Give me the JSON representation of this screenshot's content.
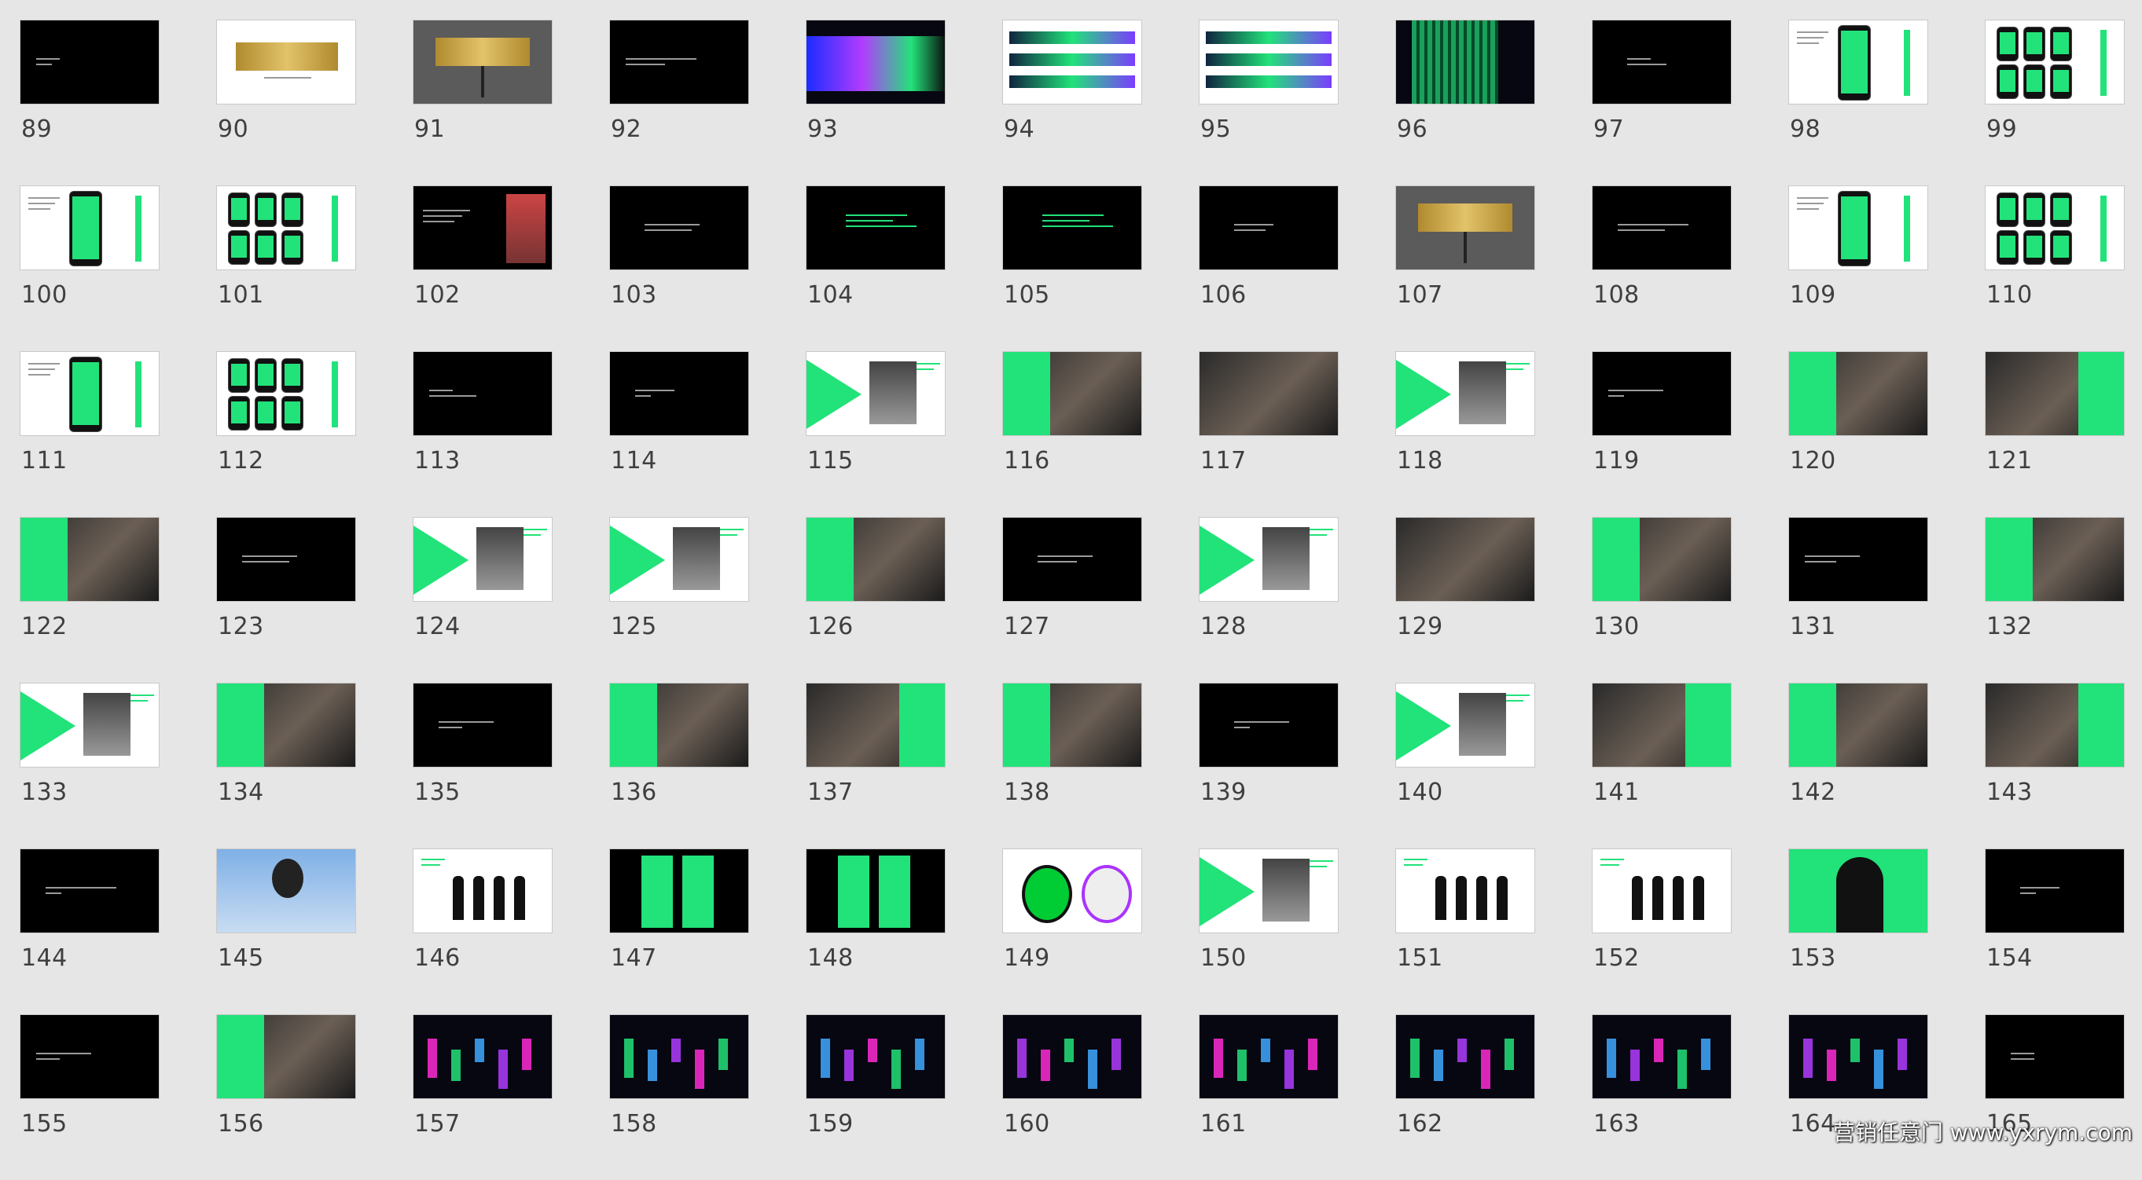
{
  "slides": [
    {
      "num": "89",
      "kind": "dark-text"
    },
    {
      "num": "90",
      "kind": "white-billboard"
    },
    {
      "num": "91",
      "kind": "gray-billboard"
    },
    {
      "num": "92",
      "kind": "dark-text"
    },
    {
      "num": "93",
      "kind": "neon-wall"
    },
    {
      "num": "94",
      "kind": "white-banner"
    },
    {
      "num": "95",
      "kind": "white-banner"
    },
    {
      "num": "96",
      "kind": "neon-grid"
    },
    {
      "num": "97",
      "kind": "dark-text"
    },
    {
      "num": "98",
      "kind": "white-phone"
    },
    {
      "num": "99",
      "kind": "white-phones"
    },
    {
      "num": "100",
      "kind": "white-phone"
    },
    {
      "num": "101",
      "kind": "white-phones"
    },
    {
      "num": "102",
      "kind": "dark-person"
    },
    {
      "num": "103",
      "kind": "dark-text"
    },
    {
      "num": "104",
      "kind": "dark-text-green"
    },
    {
      "num": "105",
      "kind": "dark-text-green"
    },
    {
      "num": "106",
      "kind": "dark-text"
    },
    {
      "num": "107",
      "kind": "gray-billboard"
    },
    {
      "num": "108",
      "kind": "dark-text"
    },
    {
      "num": "109",
      "kind": "white-phone"
    },
    {
      "num": "110",
      "kind": "white-phones"
    },
    {
      "num": "111",
      "kind": "white-phone"
    },
    {
      "num": "112",
      "kind": "white-phones"
    },
    {
      "num": "113",
      "kind": "dark-text"
    },
    {
      "num": "114",
      "kind": "dark-text"
    },
    {
      "num": "115",
      "kind": "white-green"
    },
    {
      "num": "116",
      "kind": "photo-green"
    },
    {
      "num": "117",
      "kind": "photo"
    },
    {
      "num": "118",
      "kind": "white-green"
    },
    {
      "num": "119",
      "kind": "dark-text"
    },
    {
      "num": "120",
      "kind": "photo-green"
    },
    {
      "num": "121",
      "kind": "photo-green"
    },
    {
      "num": "122",
      "kind": "photo-green"
    },
    {
      "num": "123",
      "kind": "dark-text"
    },
    {
      "num": "124",
      "kind": "white-green"
    },
    {
      "num": "125",
      "kind": "white-green"
    },
    {
      "num": "126",
      "kind": "photo-green"
    },
    {
      "num": "127",
      "kind": "dark-text"
    },
    {
      "num": "128",
      "kind": "white-green"
    },
    {
      "num": "129",
      "kind": "photo"
    },
    {
      "num": "130",
      "kind": "photo-green"
    },
    {
      "num": "131",
      "kind": "dark-text"
    },
    {
      "num": "132",
      "kind": "photo-green"
    },
    {
      "num": "133",
      "kind": "white-green"
    },
    {
      "num": "134",
      "kind": "photo-green"
    },
    {
      "num": "135",
      "kind": "dark-text"
    },
    {
      "num": "136",
      "kind": "photo-green"
    },
    {
      "num": "137",
      "kind": "photo-green"
    },
    {
      "num": "138",
      "kind": "photo-green"
    },
    {
      "num": "139",
      "kind": "dark-text"
    },
    {
      "num": "140",
      "kind": "white-green"
    },
    {
      "num": "141",
      "kind": "photo-green"
    },
    {
      "num": "142",
      "kind": "photo-green"
    },
    {
      "num": "143",
      "kind": "photo-green"
    },
    {
      "num": "144",
      "kind": "dark-text"
    },
    {
      "num": "145",
      "kind": "sky"
    },
    {
      "num": "146",
      "kind": "white-people"
    },
    {
      "num": "147",
      "kind": "dark-green-panels"
    },
    {
      "num": "148",
      "kind": "dark-green-panels"
    },
    {
      "num": "149",
      "kind": "white-badges"
    },
    {
      "num": "150",
      "kind": "white-green"
    },
    {
      "num": "151",
      "kind": "white-people"
    },
    {
      "num": "152",
      "kind": "white-people"
    },
    {
      "num": "153",
      "kind": "green-silhouette"
    },
    {
      "num": "154",
      "kind": "dark-text"
    },
    {
      "num": "155",
      "kind": "dark-text"
    },
    {
      "num": "156",
      "kind": "photo-green"
    },
    {
      "num": "157",
      "kind": "neon"
    },
    {
      "num": "158",
      "kind": "neon"
    },
    {
      "num": "159",
      "kind": "neon"
    },
    {
      "num": "160",
      "kind": "neon"
    },
    {
      "num": "161",
      "kind": "neon"
    },
    {
      "num": "162",
      "kind": "neon"
    },
    {
      "num": "163",
      "kind": "neon"
    },
    {
      "num": "164",
      "kind": "neon"
    },
    {
      "num": "165",
      "kind": "dark-text"
    }
  ],
  "watermark": "营销任意门 www.yxrym.com",
  "colors": {
    "background": "#e6e6e6",
    "accent": "#22e27a",
    "number": "#3f3f3f"
  }
}
